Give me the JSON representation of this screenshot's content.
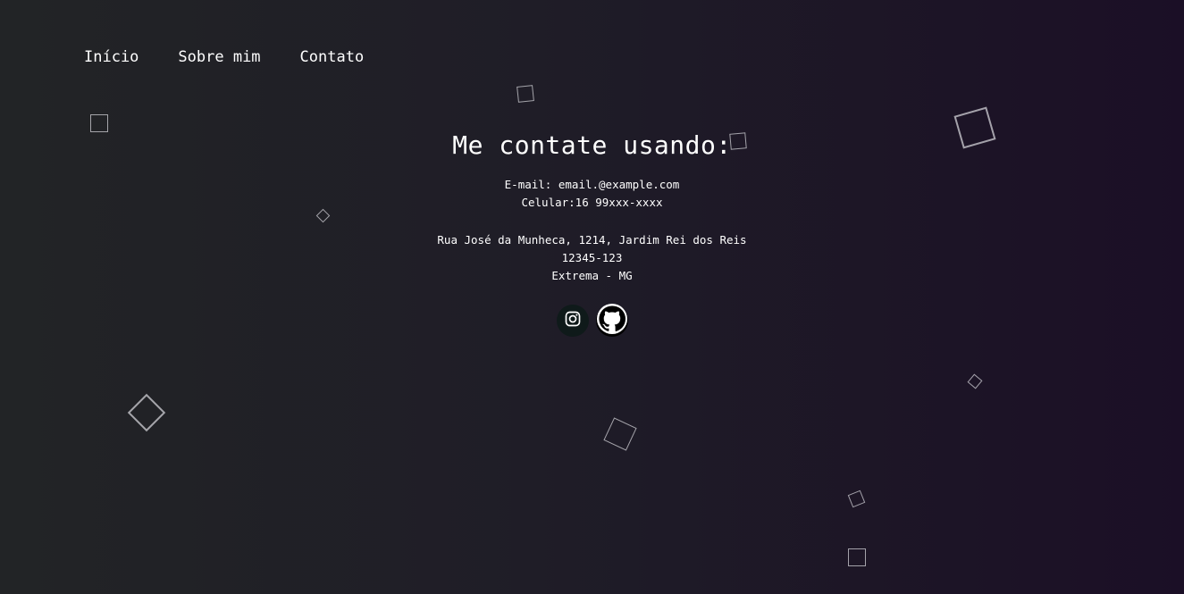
{
  "nav": {
    "items": [
      {
        "label": "Início"
      },
      {
        "label": "Sobre mim"
      },
      {
        "label": "Contato"
      }
    ]
  },
  "contact": {
    "title": "Me contate usando:",
    "email": "E-mail: email.@example.com",
    "phone": "Celular:16 99xxx-xxxx",
    "address_street": "Rua José da Munheca, 1214, Jardim Rei dos Reis",
    "address_zip": "12345-123",
    "address_city": "Extrema - MG"
  },
  "socials": [
    {
      "icon": "instagram-icon"
    },
    {
      "icon": "github-icon"
    }
  ],
  "colors": {
    "background_left": "#222426",
    "background_right": "#1b0f26",
    "text": "#ffffff"
  }
}
